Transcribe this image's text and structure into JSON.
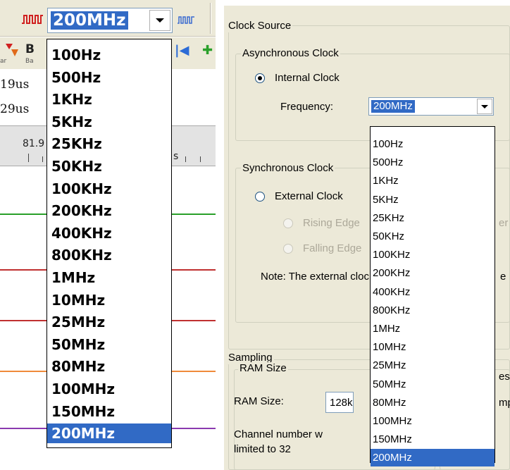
{
  "left_window": {
    "frequency_combo": {
      "selected": "200MHz"
    },
    "toolbar_icon_letter": "B",
    "toolbar_captions": [
      "ar",
      "Ba"
    ],
    "time_readouts": [
      "19us",
      "29us"
    ],
    "ruler": {
      "value": "81.9",
      "suffix": "s"
    },
    "signal_colors": [
      "#2aa02a",
      "#c03030",
      "#c03030",
      "#f08a3a",
      "#8b3ab0"
    ],
    "dropdown_options": [
      "100Hz",
      "500Hz",
      "1KHz",
      "5KHz",
      "25KHz",
      "50KHz",
      "100KHz",
      "200KHz",
      "400KHz",
      "800KHz",
      "1MHz",
      "10MHz",
      "25MHz",
      "50MHz",
      "80MHz",
      "100MHz",
      "150MHz",
      "200MHz"
    ],
    "dropdown_selected": "200MHz"
  },
  "right_window": {
    "clock_source": {
      "group_title": "Clock Source",
      "async_group_title": "Asynchronous Clock",
      "internal_clock_label": "Internal Clock",
      "internal_clock_checked": true,
      "frequency_label": "Frequency:",
      "frequency_selected": "200MHz",
      "sync_group_title": "Synchronous Clock",
      "external_clock_label": "External Clock",
      "rising_edge_label": "Rising Edge",
      "falling_edge_label": "Falling Edge",
      "note_label": "Note: The external clock frequency is lev",
      "right_fragments": [
        "er",
        "e"
      ]
    },
    "sampling": {
      "group_title": "Sampling",
      "ram_group_title": "RAM Size",
      "ram_size_label": "RAM Size:",
      "ram_size_value": "128k",
      "channel_note_line1": "Channel number w",
      "channel_note_line2": "limited to 32",
      "right_fragments": [
        "es",
        "mp"
      ]
    },
    "dropdown_options": [
      "100Hz",
      "500Hz",
      "1KHz",
      "5KHz",
      "25KHz",
      "50KHz",
      "100KHz",
      "200KHz",
      "400KHz",
      "800KHz",
      "1MHz",
      "10MHz",
      "25MHz",
      "50MHz",
      "80MHz",
      "100MHz",
      "150MHz",
      "200MHz"
    ],
    "dropdown_selected": "200MHz"
  },
  "colors": {
    "selection": "#316ac5",
    "dialog_bg": "#ece9d8"
  }
}
